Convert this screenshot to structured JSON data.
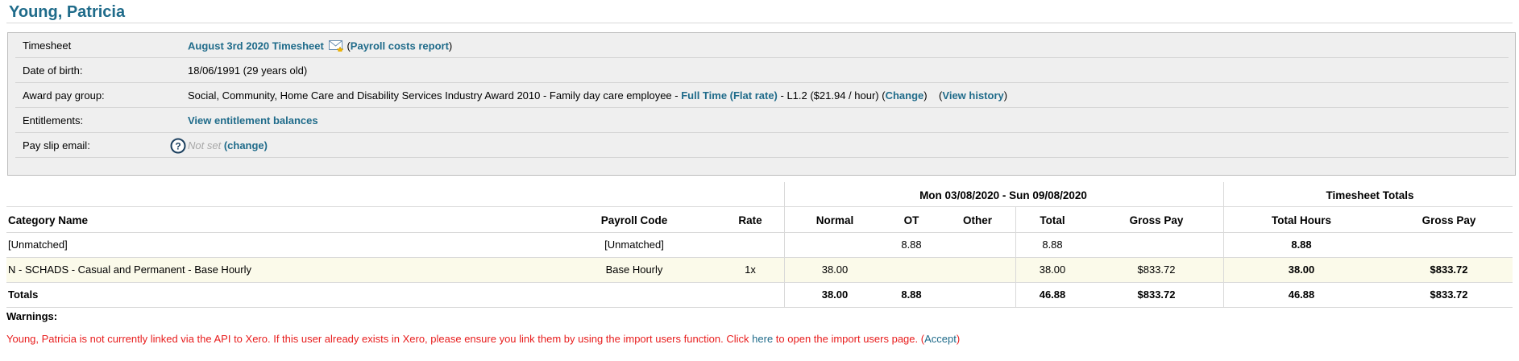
{
  "employee": {
    "name": "Young, Patricia"
  },
  "info": {
    "timesheet": {
      "label": "Timesheet",
      "link": "August 3rd 2020 Timesheet",
      "report_prefix": "(",
      "report_link": "Payroll costs report",
      "report_suffix": ")"
    },
    "dob": {
      "label": "Date of birth:",
      "value": "18/06/1991 (29 years old)"
    },
    "award": {
      "label": "Award pay group:",
      "text": "Social, Community, Home Care and Disability Services Industry Award 2010 - Family day care employee - ",
      "employment_link": "Full Time (Flat rate)",
      "rate_text": " - L1.2 ($21.94 / hour) (",
      "change_link": "Change",
      "close": ")",
      "history_open": "(",
      "history_link": "View history",
      "history_close": ")"
    },
    "entitlements": {
      "label": "Entitlements:",
      "link": "View entitlement balances"
    },
    "payslip": {
      "label": "Pay slip email:",
      "value": "Not set",
      "change_link": "(change)"
    }
  },
  "table": {
    "period_header": "Mon 03/08/2020 - Sun 09/08/2020",
    "totals_header": "Timesheet Totals",
    "columns": {
      "category": "Category Name",
      "payroll_code": "Payroll Code",
      "rate": "Rate",
      "normal": "Normal",
      "ot": "OT",
      "other": "Other",
      "total": "Total",
      "gross_pay": "Gross Pay",
      "total_hours": "Total Hours",
      "ts_gross_pay": "Gross Pay"
    },
    "rows": [
      {
        "category": "[Unmatched]",
        "payroll_code": "[Unmatched]",
        "rate": "",
        "normal": "",
        "ot": "8.88",
        "other": "",
        "total": "8.88",
        "gross_pay": "",
        "total_hours": "8.88",
        "ts_gross_pay": ""
      },
      {
        "category": "N - SCHADS - Casual and Permanent - Base Hourly",
        "payroll_code": "Base Hourly",
        "rate": "1x",
        "normal": "38.00",
        "ot": "",
        "other": "",
        "total": "38.00",
        "gross_pay": "$833.72",
        "total_hours": "38.00",
        "ts_gross_pay": "$833.72"
      }
    ],
    "totals": {
      "label": "Totals",
      "normal": "38.00",
      "ot": "8.88",
      "total": "46.88",
      "gross_pay": "$833.72",
      "total_hours": "46.88",
      "ts_gross_pay": "$833.72"
    }
  },
  "warnings": {
    "title": "Warnings:",
    "text_before": "Young, Patricia is not currently linked via the API to Xero. If this user already exists in Xero, please ensure you link them by using the import users function. Click ",
    "here_link": "here",
    "text_after": " to open the import users page. (",
    "accept_link": "Accept",
    "close": ")"
  },
  "icons": {
    "mail": "envelope-icon",
    "help": "question-circle-icon"
  },
  "colors": {
    "link": "#1f6b8a",
    "warning": "#e81d1d",
    "panel": "#efefef",
    "highlight_row": "#fbfaea"
  }
}
